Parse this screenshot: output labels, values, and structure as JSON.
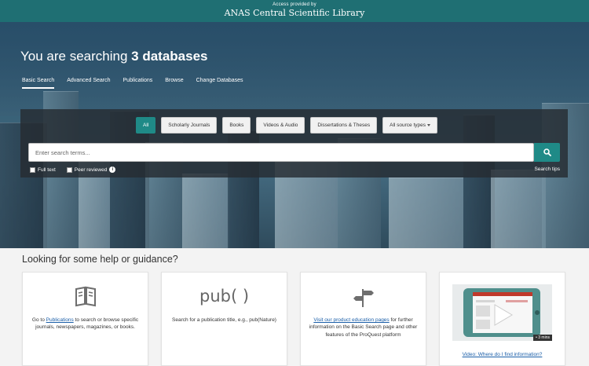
{
  "banner": {
    "access_text": "Access provided by",
    "library_name": "ANAS Central Scientific Library",
    "color": "#1f6f73"
  },
  "hero": {
    "headline_prefix": "You are searching",
    "headline_bold": "3 databases"
  },
  "nav": {
    "tabs": [
      {
        "label": "Basic Search",
        "active": true
      },
      {
        "label": "Advanced Search",
        "active": false
      },
      {
        "label": "Publications",
        "active": false
      },
      {
        "label": "Browse",
        "active": false
      },
      {
        "label": "Change Databases",
        "active": false
      }
    ]
  },
  "filters": {
    "items": [
      {
        "label": "All",
        "active": true
      },
      {
        "label": "Scholarly Journals",
        "active": false
      },
      {
        "label": "Books",
        "active": false
      },
      {
        "label": "Videos & Audio",
        "active": false
      },
      {
        "label": "Dissertations & Theses",
        "active": false
      }
    ],
    "dropdown_label": "All source types"
  },
  "search": {
    "placeholder": "Enter search terms...",
    "value": "",
    "full_text_label": "Full text",
    "peer_reviewed_label": "Peer reviewed",
    "info_glyph": "i",
    "tips_label": "Search tips",
    "accent_color": "#1f8a87"
  },
  "help": {
    "title": "Looking for some help or guidance?",
    "card1": {
      "icon": "book-icon",
      "text_before": "Go to ",
      "link": "Publications",
      "text_after": " to search or browse specific journals, newspapers, magazines, or books."
    },
    "card2": {
      "icon_text": "pub( )",
      "text": "Search for a publication title, e.g., pub(Nature)"
    },
    "card3": {
      "icon": "signpost-icon",
      "link": "Visit our product education pages",
      "text_after": " for further information on the Basic Search page and other features of the ProQuest platform"
    },
    "card4": {
      "duration": "• 3 mins",
      "link": "Video: Where do I find information?"
    }
  }
}
